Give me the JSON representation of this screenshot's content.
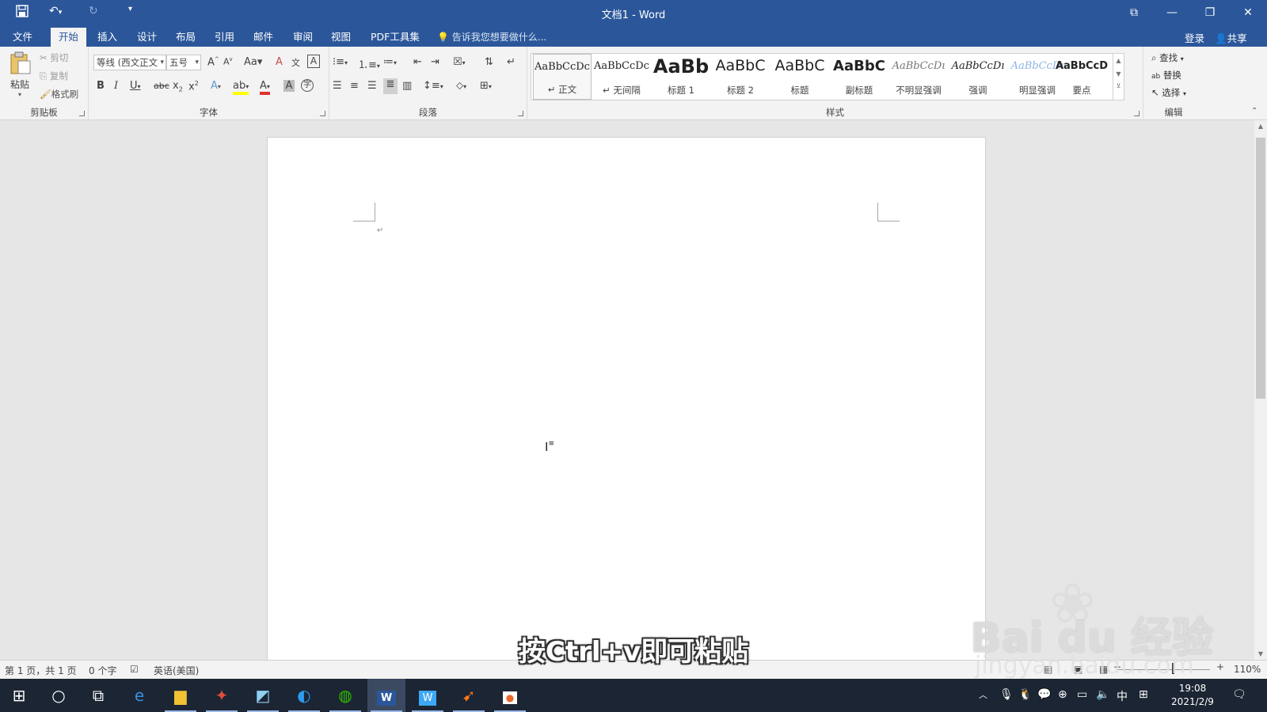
{
  "titlebar": {
    "title": "文档1 - Word",
    "save_icon": "save-icon",
    "undo_icon": "undo-icon",
    "redo_icon": "redo-icon",
    "customize_icon": "customize-quick-access-icon"
  },
  "tabs": {
    "file": "文件",
    "home": "开始",
    "insert": "插入",
    "design": "设计",
    "layout": "布局",
    "references": "引用",
    "mailings": "邮件",
    "review": "审阅",
    "view": "视图",
    "pdf": "PDF工具集",
    "tell_me": "告诉我您想要做什么...",
    "login": "登录",
    "share": "共享"
  },
  "clipboard": {
    "paste": "粘贴",
    "cut": "剪切",
    "copy": "复制",
    "format_painter": "格式刷",
    "label": "剪贴板"
  },
  "font": {
    "name": "等线 (西文正文",
    "size": "五号",
    "label": "字体"
  },
  "paragraph": {
    "label": "段落"
  },
  "styles": {
    "label": "样式",
    "items": [
      {
        "sample": "AaBbCcDc",
        "name": "↵ 正文"
      },
      {
        "sample": "AaBbCcDc",
        "name": "↵ 无间隔"
      },
      {
        "sample": "AaBb",
        "name": "标题 1"
      },
      {
        "sample": "AaBbC",
        "name": "标题 2"
      },
      {
        "sample": "AaBbC",
        "name": "标题"
      },
      {
        "sample": "AaBbC",
        "name": "副标题"
      },
      {
        "sample": "AaBbCcDı",
        "name": "不明显强调"
      },
      {
        "sample": "AaBbCcDı",
        "name": "强调"
      },
      {
        "sample": "AaBbCcDı",
        "name": "明显强调"
      },
      {
        "sample": "AaBbCcD",
        "name": "要点"
      }
    ]
  },
  "editing": {
    "find": "查找",
    "replace": "替换",
    "select": "选择",
    "label": "编辑"
  },
  "document": {
    "paragraph_mark": "↵"
  },
  "statusbar": {
    "page": "第 1 页，共 1 页",
    "words": "0 个字",
    "language": "英语(美国)",
    "zoom": "110%"
  },
  "subtitle": "按Ctrl+v即可粘贴",
  "watermark": {
    "brand": "Bai du 经验",
    "url": "jingyan.baidu.com"
  },
  "taskbar": {
    "time": "19:08",
    "date": "2021/2/9",
    "ime": "中"
  }
}
